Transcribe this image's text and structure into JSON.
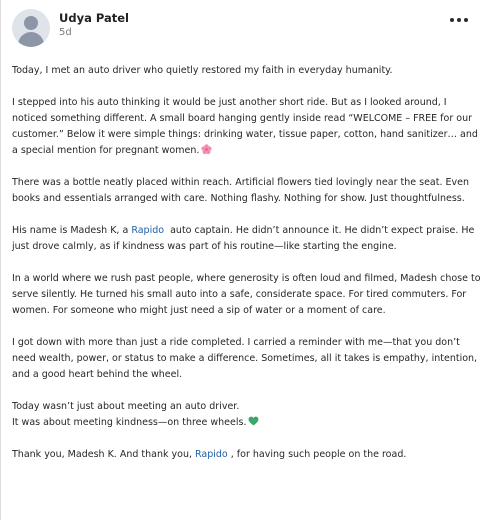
{
  "author": {
    "name": "Udya Patel",
    "time": "5d"
  },
  "post": {
    "p1": "Today, I met an auto driver who quietly restored my faith in everyday humanity.",
    "p2": "I stepped into his auto thinking it would be just another short ride. But as I looked around, I noticed something different. A small board hanging gently inside read “WELCOME – FREE for our customer.” Below it were simple things: drinking water, tissue paper, cotton, hand sanitizer… and a special mention for pregnant women.",
    "p3": "There was a bottle neatly placed within reach. Artificial flowers tied lovingly near the seat. Even books and essentials arranged with care. Nothing flashy. Nothing for show. Just thoughtfulness.",
    "p4_before": "His name is Madesh K, a ",
    "p4_link": "Rapido",
    "p4_after": "  auto captain. He didn’t announce it. He didn’t expect praise. He just drove calmly, as if kindness was part of his routine—like starting the engine.",
    "p5": "In a world where we rush past people, where generosity is often loud and filmed, Madesh chose to serve silently. He turned his small auto into a safe, considerate space. For tired commuters. For women. For someone who might just need a sip of water or a moment of care.",
    "p6": "I got down with more than just a ride completed. I carried a reminder with me—that you don’t need wealth, power, or status to make a difference. Sometimes, all it takes is empathy, intention, and a good heart behind the wheel.",
    "p7_line1": "Today wasn’t just about meeting an auto driver.",
    "p7_line2": "It was about meeting kindness—on three wheels.",
    "p8_before": "Thank you, Madesh K. And thank you, ",
    "p8_link": "Rapido",
    "p8_after": " , for having such people on the road."
  },
  "icons": {
    "flower": "cherry-blossom-icon",
    "heart": "green-heart-icon",
    "more": "more-options-icon"
  },
  "colors": {
    "link": "#1f5fa8",
    "flower": "#f48fb1",
    "heart": "#3aa76d"
  }
}
